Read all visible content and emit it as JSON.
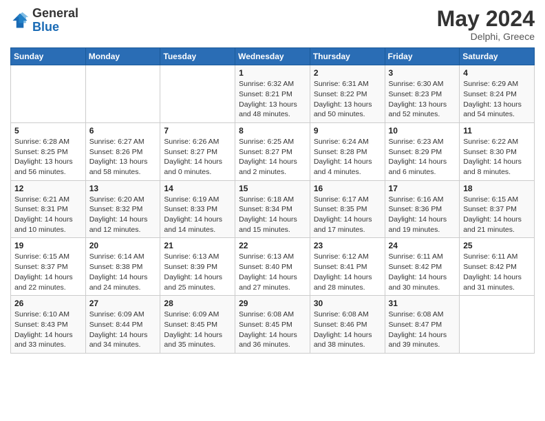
{
  "header": {
    "logo_general": "General",
    "logo_blue": "Blue",
    "month_title": "May 2024",
    "location": "Delphi, Greece"
  },
  "calendar": {
    "days": [
      "Sunday",
      "Monday",
      "Tuesday",
      "Wednesday",
      "Thursday",
      "Friday",
      "Saturday"
    ],
    "rows": [
      [
        {
          "date": "",
          "sunrise": "",
          "sunset": "",
          "daylight": ""
        },
        {
          "date": "",
          "sunrise": "",
          "sunset": "",
          "daylight": ""
        },
        {
          "date": "",
          "sunrise": "",
          "sunset": "",
          "daylight": ""
        },
        {
          "date": "1",
          "sunrise": "Sunrise: 6:32 AM",
          "sunset": "Sunset: 8:21 PM",
          "daylight": "Daylight: 13 hours and 48 minutes."
        },
        {
          "date": "2",
          "sunrise": "Sunrise: 6:31 AM",
          "sunset": "Sunset: 8:22 PM",
          "daylight": "Daylight: 13 hours and 50 minutes."
        },
        {
          "date": "3",
          "sunrise": "Sunrise: 6:30 AM",
          "sunset": "Sunset: 8:23 PM",
          "daylight": "Daylight: 13 hours and 52 minutes."
        },
        {
          "date": "4",
          "sunrise": "Sunrise: 6:29 AM",
          "sunset": "Sunset: 8:24 PM",
          "daylight": "Daylight: 13 hours and 54 minutes."
        }
      ],
      [
        {
          "date": "5",
          "sunrise": "Sunrise: 6:28 AM",
          "sunset": "Sunset: 8:25 PM",
          "daylight": "Daylight: 13 hours and 56 minutes."
        },
        {
          "date": "6",
          "sunrise": "Sunrise: 6:27 AM",
          "sunset": "Sunset: 8:26 PM",
          "daylight": "Daylight: 13 hours and 58 minutes."
        },
        {
          "date": "7",
          "sunrise": "Sunrise: 6:26 AM",
          "sunset": "Sunset: 8:27 PM",
          "daylight": "Daylight: 14 hours and 0 minutes."
        },
        {
          "date": "8",
          "sunrise": "Sunrise: 6:25 AM",
          "sunset": "Sunset: 8:27 PM",
          "daylight": "Daylight: 14 hours and 2 minutes."
        },
        {
          "date": "9",
          "sunrise": "Sunrise: 6:24 AM",
          "sunset": "Sunset: 8:28 PM",
          "daylight": "Daylight: 14 hours and 4 minutes."
        },
        {
          "date": "10",
          "sunrise": "Sunrise: 6:23 AM",
          "sunset": "Sunset: 8:29 PM",
          "daylight": "Daylight: 14 hours and 6 minutes."
        },
        {
          "date": "11",
          "sunrise": "Sunrise: 6:22 AM",
          "sunset": "Sunset: 8:30 PM",
          "daylight": "Daylight: 14 hours and 8 minutes."
        }
      ],
      [
        {
          "date": "12",
          "sunrise": "Sunrise: 6:21 AM",
          "sunset": "Sunset: 8:31 PM",
          "daylight": "Daylight: 14 hours and 10 minutes."
        },
        {
          "date": "13",
          "sunrise": "Sunrise: 6:20 AM",
          "sunset": "Sunset: 8:32 PM",
          "daylight": "Daylight: 14 hours and 12 minutes."
        },
        {
          "date": "14",
          "sunrise": "Sunrise: 6:19 AM",
          "sunset": "Sunset: 8:33 PM",
          "daylight": "Daylight: 14 hours and 14 minutes."
        },
        {
          "date": "15",
          "sunrise": "Sunrise: 6:18 AM",
          "sunset": "Sunset: 8:34 PM",
          "daylight": "Daylight: 14 hours and 15 minutes."
        },
        {
          "date": "16",
          "sunrise": "Sunrise: 6:17 AM",
          "sunset": "Sunset: 8:35 PM",
          "daylight": "Daylight: 14 hours and 17 minutes."
        },
        {
          "date": "17",
          "sunrise": "Sunrise: 6:16 AM",
          "sunset": "Sunset: 8:36 PM",
          "daylight": "Daylight: 14 hours and 19 minutes."
        },
        {
          "date": "18",
          "sunrise": "Sunrise: 6:15 AM",
          "sunset": "Sunset: 8:37 PM",
          "daylight": "Daylight: 14 hours and 21 minutes."
        }
      ],
      [
        {
          "date": "19",
          "sunrise": "Sunrise: 6:15 AM",
          "sunset": "Sunset: 8:37 PM",
          "daylight": "Daylight: 14 hours and 22 minutes."
        },
        {
          "date": "20",
          "sunrise": "Sunrise: 6:14 AM",
          "sunset": "Sunset: 8:38 PM",
          "daylight": "Daylight: 14 hours and 24 minutes."
        },
        {
          "date": "21",
          "sunrise": "Sunrise: 6:13 AM",
          "sunset": "Sunset: 8:39 PM",
          "daylight": "Daylight: 14 hours and 25 minutes."
        },
        {
          "date": "22",
          "sunrise": "Sunrise: 6:13 AM",
          "sunset": "Sunset: 8:40 PM",
          "daylight": "Daylight: 14 hours and 27 minutes."
        },
        {
          "date": "23",
          "sunrise": "Sunrise: 6:12 AM",
          "sunset": "Sunset: 8:41 PM",
          "daylight": "Daylight: 14 hours and 28 minutes."
        },
        {
          "date": "24",
          "sunrise": "Sunrise: 6:11 AM",
          "sunset": "Sunset: 8:42 PM",
          "daylight": "Daylight: 14 hours and 30 minutes."
        },
        {
          "date": "25",
          "sunrise": "Sunrise: 6:11 AM",
          "sunset": "Sunset: 8:42 PM",
          "daylight": "Daylight: 14 hours and 31 minutes."
        }
      ],
      [
        {
          "date": "26",
          "sunrise": "Sunrise: 6:10 AM",
          "sunset": "Sunset: 8:43 PM",
          "daylight": "Daylight: 14 hours and 33 minutes."
        },
        {
          "date": "27",
          "sunrise": "Sunrise: 6:09 AM",
          "sunset": "Sunset: 8:44 PM",
          "daylight": "Daylight: 14 hours and 34 minutes."
        },
        {
          "date": "28",
          "sunrise": "Sunrise: 6:09 AM",
          "sunset": "Sunset: 8:45 PM",
          "daylight": "Daylight: 14 hours and 35 minutes."
        },
        {
          "date": "29",
          "sunrise": "Sunrise: 6:08 AM",
          "sunset": "Sunset: 8:45 PM",
          "daylight": "Daylight: 14 hours and 36 minutes."
        },
        {
          "date": "30",
          "sunrise": "Sunrise: 6:08 AM",
          "sunset": "Sunset: 8:46 PM",
          "daylight": "Daylight: 14 hours and 38 minutes."
        },
        {
          "date": "31",
          "sunrise": "Sunrise: 6:08 AM",
          "sunset": "Sunset: 8:47 PM",
          "daylight": "Daylight: 14 hours and 39 minutes."
        },
        {
          "date": "",
          "sunrise": "",
          "sunset": "",
          "daylight": ""
        }
      ]
    ]
  }
}
